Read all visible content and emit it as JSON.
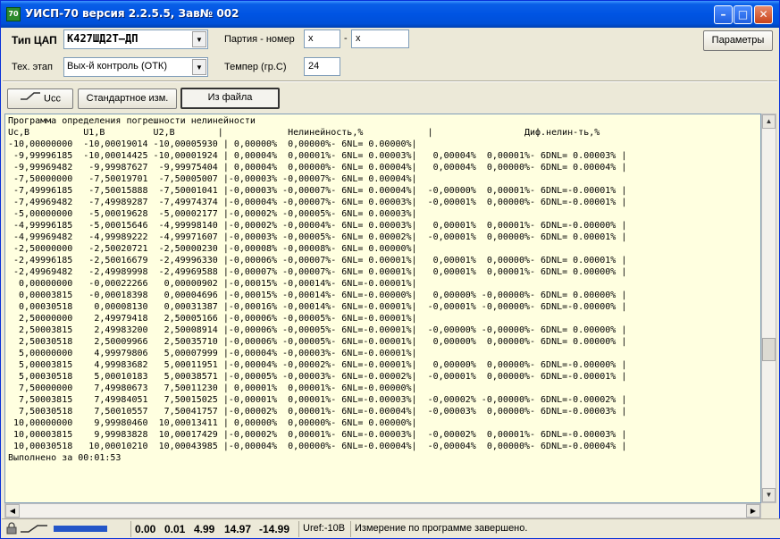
{
  "window": {
    "title": "УИСП-70 версия 2.2.5.5, Зав№ 002",
    "icon_label": "70"
  },
  "controls": {
    "dac_type_label": "Тип ЦАП",
    "dac_type_value": "К427ШД2Т–ДП",
    "batch_label": "Партия - номер",
    "batch_value": "x",
    "batch_dash": "-",
    "number_value": "x",
    "params_button": "Параметры",
    "stage_label": "Тех. этап",
    "stage_value": "Вых-й контроль (ОТК)",
    "temp_label": "Темпер (гр.С)",
    "temp_value": "24"
  },
  "toolbar": {
    "ucc_button": "Ucc",
    "standard_button": "Стандартное изм.",
    "from_file_button": "Из файла"
  },
  "log": {
    "lines": [
      "Программа определения погрешности нелинейности",
      "Uc,B          U1,B         U2,B        |            Нелинейность,%            |                 Диф.нелин-ть,%",
      "-10,00000000  -10,00019014 -10,00005930 | 0,00000%  0,00000%- 6NL= 0.00000%|",
      " -9,99996185  -10,00014425 -10,00001924 | 0,00004%  0,00001%- 6NL= 0.00003%|   0,00004%  0,00001%- 6DNL= 0.00003% |",
      " -9,99969482   -9,99987627  -9,99975404 | 0,00004%  0,00000%- 6NL= 0.00004%|   0,00004%  0,00000%- 6DNL= 0.00004% |",
      " -7,50000000   -7,50019701  -7,50005007 |-0,00003% -0,00007%- 6NL= 0.00004%|",
      " -7,49996185   -7,50015888  -7,50001041 |-0,00003% -0,00007%- 6NL= 0.00004%|  -0,00000%  0,00001%- 6DNL=-0.00001% |",
      " -7,49969482   -7,49989287  -7,49974374 |-0,00004% -0,00007%- 6NL= 0.00003%|  -0,00001%  0,00000%- 6DNL=-0.00001% |",
      " -5,00000000   -5,00019628  -5,00002177 |-0,00002% -0,00005%- 6NL= 0.00003%|",
      " -4,99996185   -5,00015646  -4,99998140 |-0,00002% -0,00004%- 6NL= 0.00003%|   0,00001%  0,00001%- 6DNL=-0.00000% |",
      " -4,99969482   -4,99989222  -4,99971607 |-0,00003% -0,00005%- 6NL= 0.00002%|  -0,00001%  0,00000%- 6DNL= 0.00001% |",
      " -2,50000000   -2,50020721  -2,50000230 |-0,00008% -0,00008%- 6NL= 0.00000%|",
      " -2,49996185   -2,50016679  -2,49996330 |-0,00006% -0,00007%- 6NL= 0.00001%|   0,00001%  0,00000%- 6DNL= 0.00001% |",
      " -2,49969482   -2,49989998  -2,49969588 |-0,00007% -0,00007%- 6NL= 0.00001%|   0,00001%  0,00001%- 6DNL= 0.00000% |",
      "  0,00000000   -0,00022266   0,00000902 |-0,00015% -0,00014%- 6NL=-0.00001%|",
      "  0,00003815   -0,00018398   0,00004696 |-0,00015% -0,00014%- 6NL=-0.00000%|   0,00000% -0,00000%- 6DNL= 0.00000% |",
      "  0,00030518    0,00008130   0,00031387 |-0,00016% -0,00014%- 6NL=-0.00001%|  -0,00001% -0,00000%- 6DNL=-0.00000% |",
      "  2,50000000    2,49979418   2,50005166 |-0,00006% -0,00005%- 6NL=-0.00001%|",
      "  2,50003815    2,49983200   2,50008914 |-0,00006% -0,00005%- 6NL=-0.00001%|  -0,00000% -0,00000%- 6DNL= 0.00000% |",
      "  2,50030518    2,50009966   2,50035710 |-0,00006% -0,00005%- 6NL=-0.00001%|   0,00000%  0,00000%- 6DNL= 0.00000% |",
      "  5,00000000    4,99979806   5,00007999 |-0,00004% -0,00003%- 6NL=-0.00001%|",
      "  5,00003815    4,99983682   5,00011951 |-0,00004% -0,00002%- 6NL=-0.00001%|   0,00000%  0,00000%- 6DNL=-0.00000% |",
      "  5,00030518    5,00010183   5,00038571 |-0,00005% -0,00003%- 6NL=-0.00002%|  -0,00001%  0,00000%- 6DNL=-0.00001% |",
      "  7,50000000    7,49980673   7,50011230 | 0,00001%  0,00001%- 6NL=-0.00000%|",
      "  7,50003815    7,49984051   7,50015025 |-0,00001%  0,00001%- 6NL=-0.00003%|  -0,00002% -0,00000%- 6DNL=-0.00002% |",
      "  7,50030518    7,50010557   7,50041757 |-0,00002%  0,00001%- 6NL=-0.00004%|  -0,00003%  0,00000%- 6DNL=-0.00003% |",
      " 10,00000000    9,99980460  10,00013411 | 0,00000%  0,00000%- 6NL= 0.00000%|",
      " 10,00003815    9,99983828  10,00017429 |-0,00002%  0,00001%- 6NL=-0.00003%|  -0,00002%  0,00001%- 6DNL=-0.00003% |",
      " 10,00030518   10,00010210  10,00043985 |-0,00004%  0,00000%- 6NL=-0.00004%|  -0,00004%  0,00000%- 6DNL=-0.00004% |",
      "Выполнено за 00:01:53"
    ]
  },
  "statusbar": {
    "v1": "0.00",
    "v2": "0.01",
    "v3": "4.99",
    "v4": "14.97",
    "v5": "-14.99",
    "uref": "Uref:-10В",
    "message": "Измерение по программе завершено."
  }
}
